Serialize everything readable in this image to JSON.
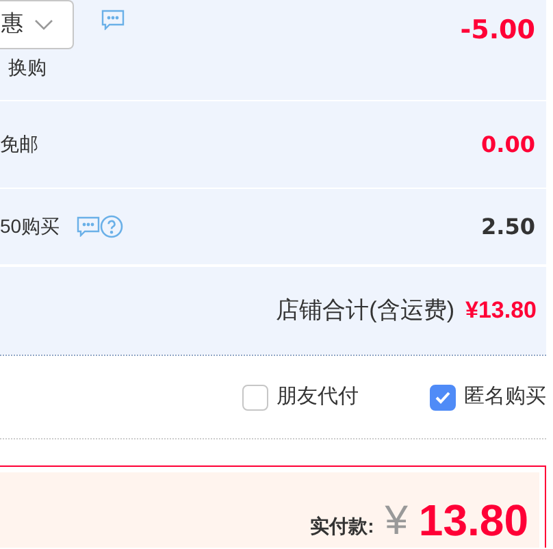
{
  "promo_rows": [
    {
      "kind": "select",
      "select_value": "惠",
      "note": "换购",
      "amount": "-5.00",
      "highlight": true,
      "chat": true,
      "help": false
    },
    {
      "kind": "plain",
      "label": "免邮",
      "amount": "0.00",
      "highlight": true,
      "chat": false,
      "help": false
    },
    {
      "kind": "plain",
      "label": "50购买",
      "amount": "2.50",
      "highlight": false,
      "chat": true,
      "help": true
    }
  ],
  "shop_total": {
    "label": "店铺合计(含运费)",
    "amount": "¥13.80"
  },
  "options": [
    {
      "label": "朋友代付",
      "checked": false
    },
    {
      "label": "匿名购买",
      "checked": true
    }
  ],
  "payment": {
    "label": "实付款:",
    "currency": "¥",
    "amount": "13.80"
  }
}
